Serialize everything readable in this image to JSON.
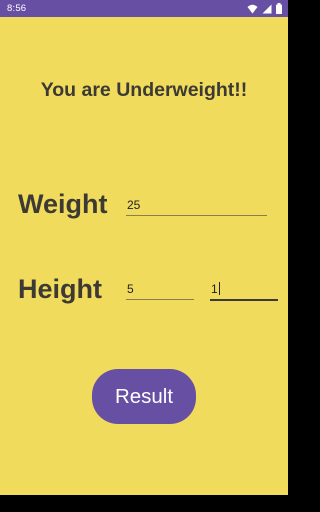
{
  "status_bar": {
    "time": "8:56",
    "background": "#6750a4",
    "icons": [
      "wifi-icon",
      "signal-icon",
      "battery-icon"
    ]
  },
  "screen": {
    "background": "#f0db5d"
  },
  "result_message": "You are Underweight!!",
  "weight": {
    "label": "Weight",
    "value": "25"
  },
  "height": {
    "label": "Height",
    "feet_value": "5",
    "inches_value": "1"
  },
  "result_button": {
    "label": "Result",
    "color": "#6750a4"
  }
}
